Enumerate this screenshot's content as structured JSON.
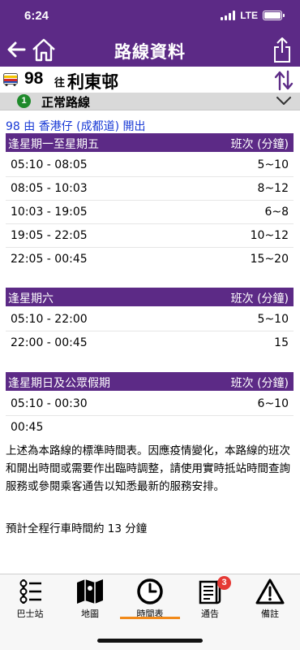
{
  "status_bar": {
    "time": "6:24",
    "network": "LTE"
  },
  "nav": {
    "title": "路線資料"
  },
  "route": {
    "number": "98",
    "direction_prefix": "往",
    "destination": "利東邨"
  },
  "variant": {
    "index": "1",
    "label": "正常路線"
  },
  "origin_text": "98 由 香港仔 (成都道) 開出",
  "schedules": [
    {
      "heading": "逢星期一至星期五",
      "freq_heading": "班次 (分鐘)",
      "rows": [
        {
          "time": "05:10 - 08:05",
          "freq": "5~10"
        },
        {
          "time": "08:05 - 10:03",
          "freq": "8~12"
        },
        {
          "time": "10:03 - 19:05",
          "freq": "6~8"
        },
        {
          "time": "19:05 - 22:05",
          "freq": "10~12"
        },
        {
          "time": "22:05 - 00:45",
          "freq": "15~20"
        }
      ]
    },
    {
      "heading": "逢星期六",
      "freq_heading": "班次 (分鐘)",
      "rows": [
        {
          "time": "05:10 - 22:00",
          "freq": "5~10"
        },
        {
          "time": "22:00 - 00:45",
          "freq": "15"
        }
      ]
    },
    {
      "heading": "逢星期日及公眾假期",
      "freq_heading": "班次 (分鐘)",
      "rows": [
        {
          "time": "05:10 - 00:30",
          "freq": "6~10"
        },
        {
          "time": "00:45",
          "freq": ""
        }
      ]
    }
  ],
  "note": "上述為本路線的標準時間表。因應疫情變化，本路線的班次和開出時間或需要作出臨時調整，請使用實時抵站時間查詢服務或參閱乘客通告以知悉最新的服務安排。",
  "journey_time": "預計全程行車時間約 13 分鐘",
  "tabs": [
    {
      "label": "巴士站",
      "icon": "bus-stop-list-icon"
    },
    {
      "label": "地圖",
      "icon": "map-icon"
    },
    {
      "label": "時間表",
      "icon": "clock-icon",
      "selected": true
    },
    {
      "label": "通告",
      "icon": "notice-icon",
      "badge": "3"
    },
    {
      "label": "備註",
      "icon": "warning-icon"
    }
  ],
  "colors": {
    "header": "#5c2a86",
    "accent": "#f28a1a",
    "link": "#1a3bd6",
    "badge": "#e53935",
    "variant_badge": "#1f8a2b"
  }
}
